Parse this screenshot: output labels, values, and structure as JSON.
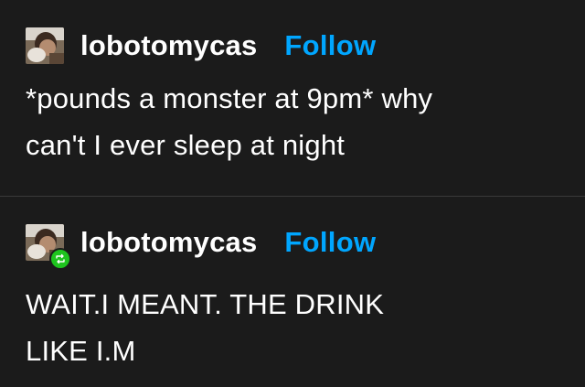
{
  "posts": [
    {
      "username": "lobotomycas",
      "follow_label": "Follow",
      "avatar_icon": "user-avatar-photo",
      "lines": [
        "*pounds a monster at 9pm* why",
        "can't I ever sleep at night"
      ]
    },
    {
      "username": "lobotomycas",
      "follow_label": "Follow",
      "avatar_icon": "user-avatar-photo",
      "badge_icon": "reblog-icon",
      "lines": [
        "WAIT.I MEANT. THE DRINK",
        "LIKE I.M"
      ]
    }
  ],
  "colors": {
    "background": "#1b1b1b",
    "text": "#ffffff",
    "follow": "#00a6ff",
    "reblog_badge": "#1ec41e"
  }
}
